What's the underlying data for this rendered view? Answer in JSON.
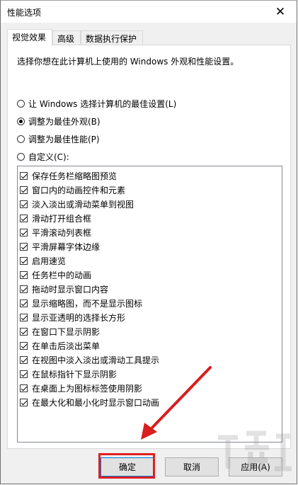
{
  "window": {
    "title": "性能选项",
    "close_icon": "✕"
  },
  "tabs": [
    {
      "label": "视觉效果",
      "active": true
    },
    {
      "label": "高级",
      "active": false
    },
    {
      "label": "数据执行保护",
      "active": false
    }
  ],
  "panel": {
    "description": "选择你想在此计算机上使用的 Windows 外观和性能设置。",
    "radios": [
      {
        "label": "让 Windows 选择计算机的最佳设置(L)",
        "checked": false
      },
      {
        "label": "调整为最佳外观(B)",
        "checked": true
      },
      {
        "label": "调整为最佳性能(P)",
        "checked": false
      },
      {
        "label": "自定义(C):",
        "checked": false
      }
    ],
    "effects": [
      {
        "label": "保存任务栏缩略图预览",
        "checked": true
      },
      {
        "label": "窗口内的动画控件和元素",
        "checked": true
      },
      {
        "label": "淡入淡出或滑动菜单到视图",
        "checked": true
      },
      {
        "label": "滑动打开组合框",
        "checked": true
      },
      {
        "label": "平滑滚动列表框",
        "checked": true
      },
      {
        "label": "平滑屏幕字体边缘",
        "checked": true
      },
      {
        "label": "启用速览",
        "checked": true
      },
      {
        "label": "任务栏中的动画",
        "checked": true
      },
      {
        "label": "拖动时显示窗口内容",
        "checked": true
      },
      {
        "label": "显示缩略图，而不是显示图标",
        "checked": true
      },
      {
        "label": "显示亚透明的选择长方形",
        "checked": true
      },
      {
        "label": "在窗口下显示阴影",
        "checked": true
      },
      {
        "label": "在单击后淡出菜单",
        "checked": true
      },
      {
        "label": "在视图中淡入淡出或滑动工具提示",
        "checked": true
      },
      {
        "label": "在鼠标指针下显示阴影",
        "checked": true
      },
      {
        "label": "在桌面上为图标标签使用阴影",
        "checked": true
      },
      {
        "label": "在最大化和最小化时显示窗口动画",
        "checked": true
      }
    ]
  },
  "buttons": {
    "ok": "确定",
    "cancel": "取消",
    "apply": "应用(A)"
  },
  "annotation": {
    "highlight_color": "#e02020",
    "arrow_color": "#d81e1e"
  }
}
